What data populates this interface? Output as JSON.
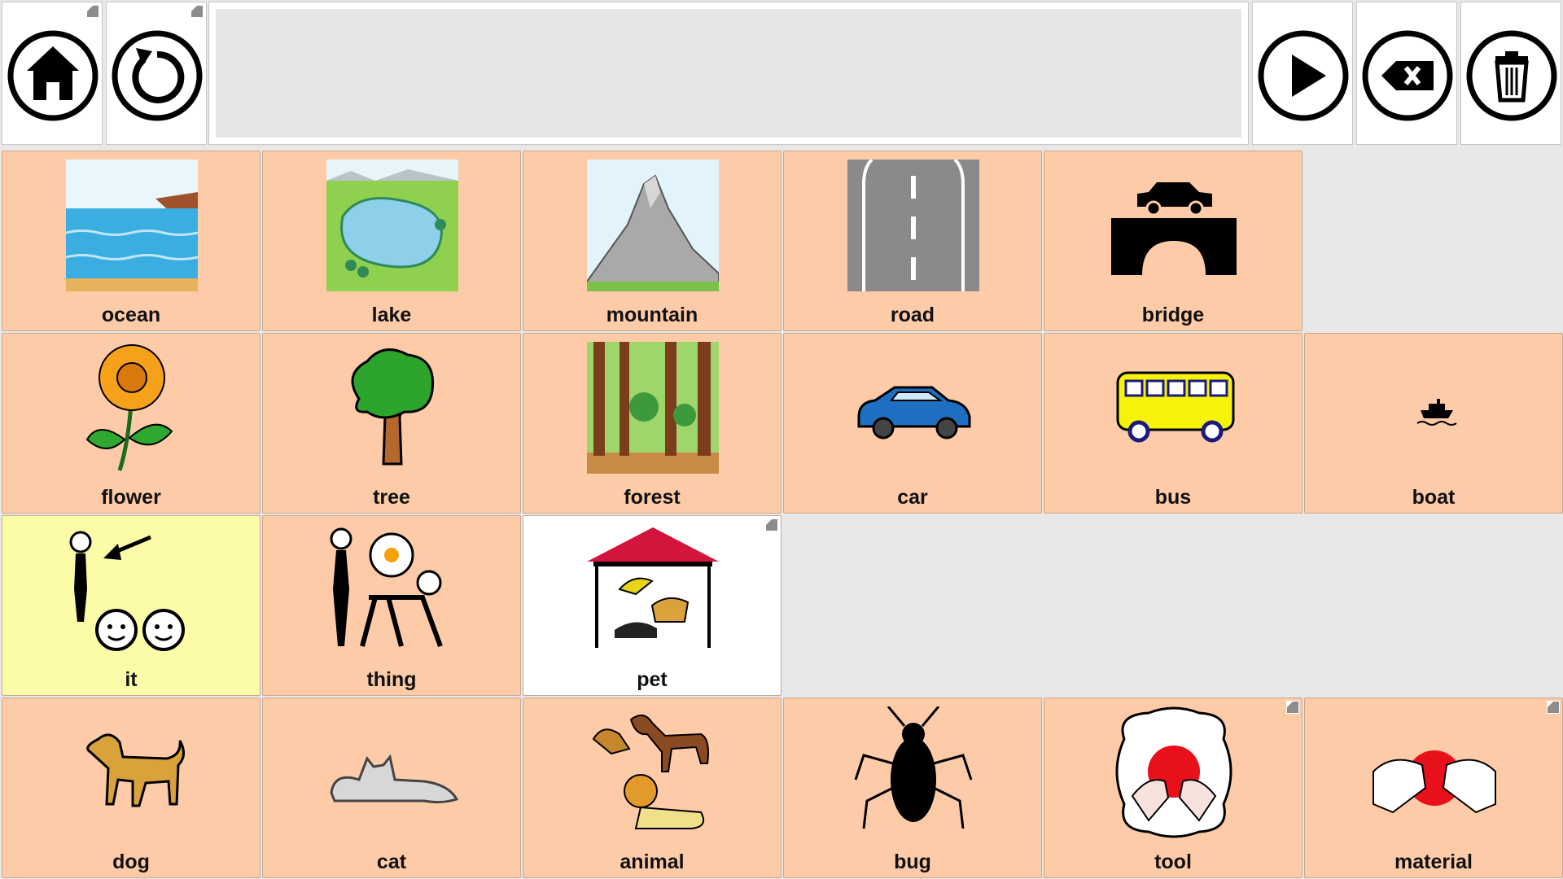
{
  "toolbar": {
    "home_icon": "home-icon",
    "back_icon": "undo-icon",
    "speak_icon": "play-icon",
    "backspace_icon": "backspace-icon",
    "clear_icon": "trash-icon"
  },
  "message_bar": {
    "text": ""
  },
  "cells": {
    "ocean": "ocean",
    "lake": "lake",
    "mountain": "mountain",
    "road": "road",
    "bridge": "bridge",
    "flower": "flower",
    "tree": "tree",
    "forest": "forest",
    "car": "car",
    "bus": "bus",
    "boat": "boat",
    "it": "it",
    "thing": "thing",
    "pet": "pet",
    "dog": "dog",
    "cat": "cat",
    "animal": "animal",
    "bug": "bug",
    "tool": "tool",
    "material": "material"
  },
  "colors": {
    "noun_cell": "#fdcba8",
    "pronoun_cell": "#fcfca8",
    "folder_cell": "#ffffff",
    "background": "#e8e8e8"
  }
}
